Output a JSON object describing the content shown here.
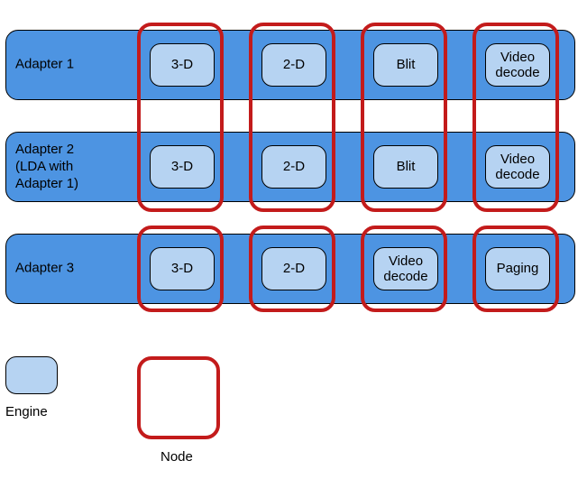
{
  "adapters": [
    {
      "label": "Adapter 1",
      "engines": [
        "3-D",
        "2-D",
        "Blit",
        "Video\ndecode"
      ]
    },
    {
      "label": "Adapter 2\n(LDA with\nAdapter 1)",
      "engines": [
        "3-D",
        "2-D",
        "Blit",
        "Video\ndecode"
      ]
    },
    {
      "label": "Adapter 3",
      "engines": [
        "3-D",
        "2-D",
        "Video\ndecode",
        "Paging"
      ]
    }
  ],
  "legend": {
    "engine": "Engine",
    "node": "Node"
  }
}
